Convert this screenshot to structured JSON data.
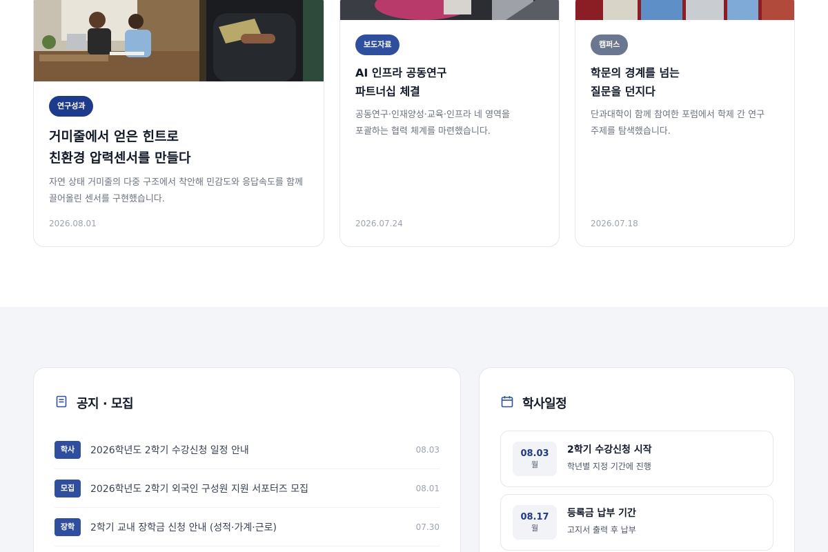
{
  "news": [
    {
      "badge": "연구성과",
      "title_line1": "거미줄에서 얻은 힌트로",
      "title_line2": "친환경 압력센서를 만들다",
      "desc_line1": "자연 상태 거미줄의 다중 구조에서 착안해 민감도와 응답속도를 함께",
      "desc_line2": "끌어올린 센서를 구현했습니다.",
      "date": "2026.08.01",
      "image": "students-studying-photo"
    },
    {
      "badge": "보도자료",
      "title_line1": "AI 인프라 공동연구",
      "title_line2": "파트너십 체결",
      "desc_line1": "공동연구·인재양성·교육·인프라 네 영역을",
      "desc_line2": "포괄하는 협력 체계를 마련했습니다.",
      "date": "2026.07.24",
      "image": "meeting-photo"
    },
    {
      "badge": "캠퍼스",
      "title_line1": "학문의 경계를 넘는",
      "title_line2": "질문을 던지다",
      "desc_line1": "단과대학이 함께 참여한 포럼에서 학제 간 연구",
      "desc_line2": "주제를 탐색했습니다.",
      "date": "2026.07.18",
      "image": "campus-people-photo"
    }
  ],
  "notices": {
    "title": "공지 · 모집",
    "icon": "document-icon",
    "items": [
      {
        "tag": "학사",
        "text": "2026학년도 2학기 수강신청 일정 안내",
        "date": "08.03"
      },
      {
        "tag": "모집",
        "text": "2026학년도 2학기 외국인 구성원 지원 서포터즈 모집",
        "date": "08.01"
      },
      {
        "tag": "장학",
        "text": "2학기 교내 장학금 신청 안내 (성적·가계·근로)",
        "date": "07.30"
      }
    ]
  },
  "schedule": {
    "title": "학사일정",
    "icon": "calendar-icon",
    "items": [
      {
        "date": "08.03",
        "month": "월",
        "title": "2학기 수강신청 시작",
        "sub": "학년별 지정 기간에 진행"
      },
      {
        "date": "08.17",
        "month": "월",
        "title": "등록금 납부 기간",
        "sub": "고지서 출력 후 납부"
      }
    ]
  },
  "colors": {
    "primary": "#1e3a8a",
    "badge_blue": "#2f4f9e",
    "badge_gray": "#6b7690",
    "section_bg": "#f3f5f8"
  }
}
